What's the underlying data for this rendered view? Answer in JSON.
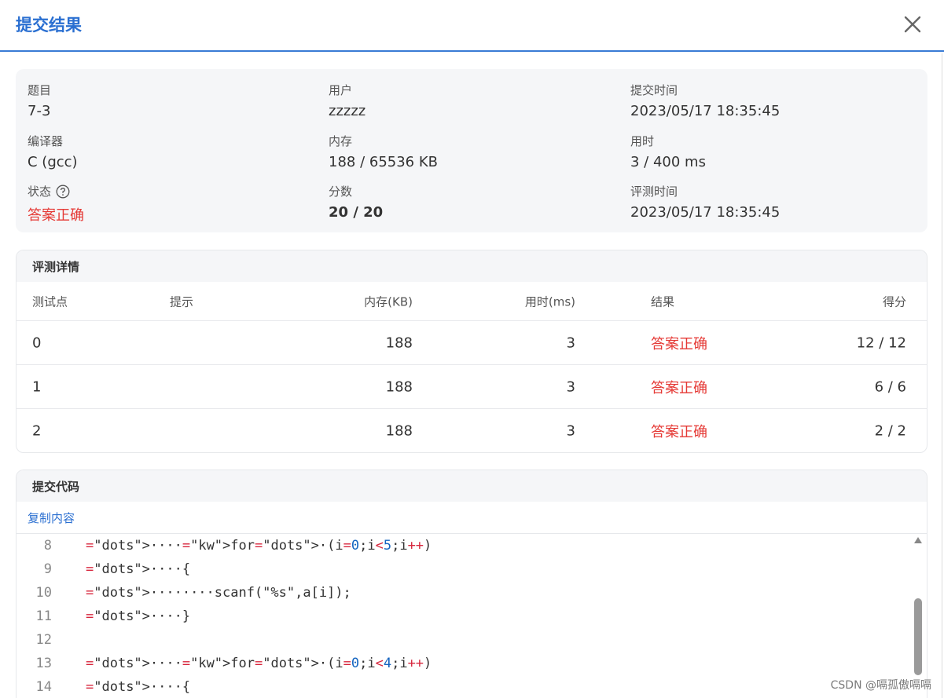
{
  "dialog": {
    "title": "提交结果",
    "close_icon": "close-icon"
  },
  "info": {
    "problem_label": "题目",
    "problem_value": "7-3",
    "user_label": "用户",
    "user_value": "zzzzz",
    "submit_time_label": "提交时间",
    "submit_time_value": "2023/05/17 18:35:45",
    "compiler_label": "编译器",
    "compiler_value": "C (gcc)",
    "memory_label": "内存",
    "memory_value": "188 / 65536 KB",
    "time_label": "用时",
    "time_value": "3 / 400 ms",
    "status_label": "状态",
    "status_value": "答案正确",
    "score_label": "分数",
    "score_value": "20 / 20",
    "judge_time_label": "评测时间",
    "judge_time_value": "2023/05/17 18:35:45"
  },
  "details": {
    "title": "评测详情",
    "columns": [
      "测试点",
      "提示",
      "内存(KB)",
      "用时(ms)",
      "结果",
      "得分"
    ],
    "rows": [
      {
        "point": "0",
        "hint": "",
        "memory": "188",
        "time": "3",
        "result": "答案正确",
        "score": "12 / 12"
      },
      {
        "point": "1",
        "hint": "",
        "memory": "188",
        "time": "3",
        "result": "答案正确",
        "score": "6 / 6"
      },
      {
        "point": "2",
        "hint": "",
        "memory": "188",
        "time": "3",
        "result": "答案正确",
        "score": "2 / 2"
      }
    ]
  },
  "code": {
    "title": "提交代码",
    "copy_label": "复制内容",
    "lines": [
      {
        "num": "8",
        "text": "····for·(i=0;i<5;i++)"
      },
      {
        "num": "9",
        "text": "····{"
      },
      {
        "num": "10",
        "text": "········scanf(\"%s\",a[i]);"
      },
      {
        "num": "11",
        "text": "····}"
      },
      {
        "num": "12",
        "text": ""
      },
      {
        "num": "13",
        "text": "····for·(i=0;i<4;i++)"
      },
      {
        "num": "14",
        "text": "····{"
      }
    ]
  },
  "watermark": "CSDN @嗝孤傲嗝嗝",
  "colors": {
    "accent": "#2a6fd1",
    "success_text": "#e53935",
    "panel_bg": "#f5f6f8"
  }
}
